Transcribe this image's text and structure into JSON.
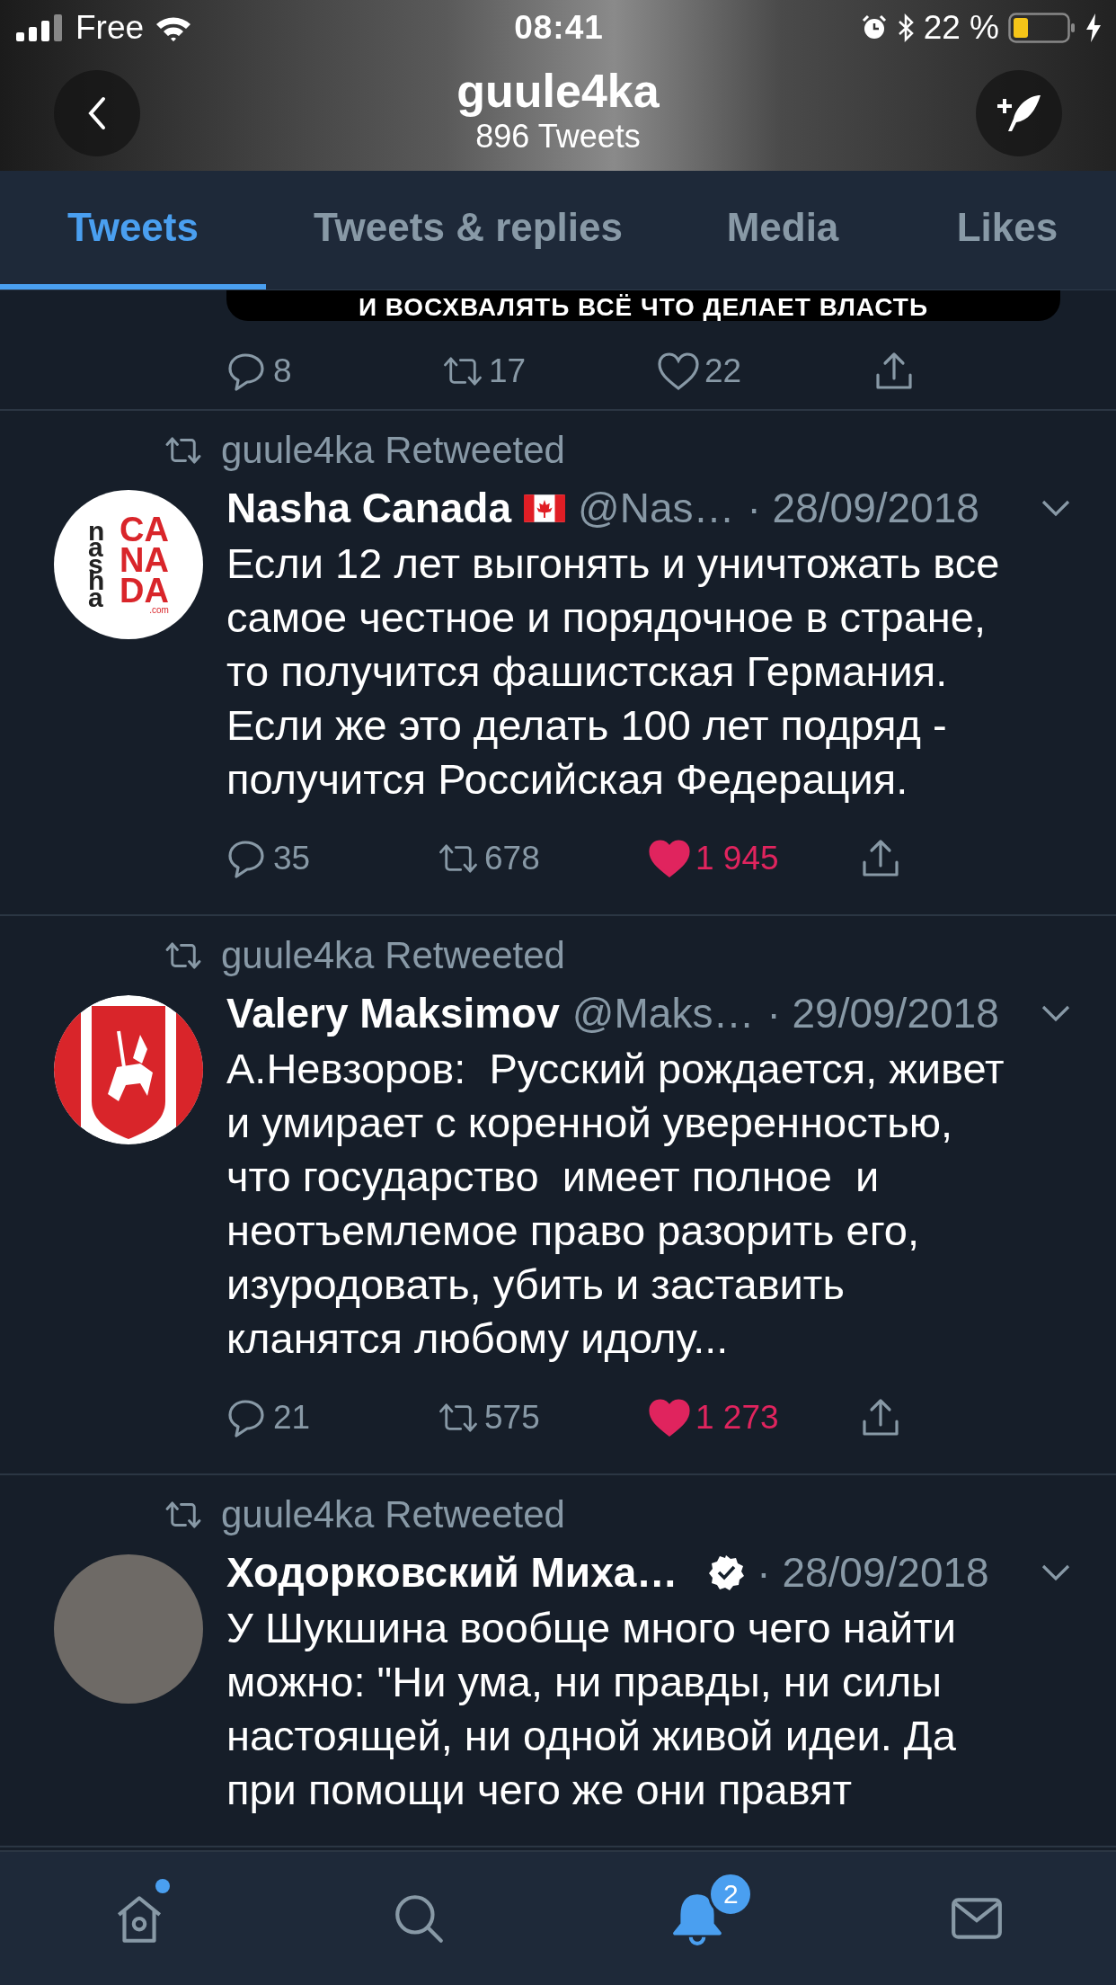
{
  "status_bar": {
    "carrier": "Free",
    "time": "08:41",
    "battery": "22 %"
  },
  "header": {
    "title": "guule4ka",
    "subtitle": "896 Tweets"
  },
  "tabs": [
    {
      "label": "Tweets",
      "selected": true
    },
    {
      "label": "Tweets & replies",
      "selected": false
    },
    {
      "label": "Media",
      "selected": false
    },
    {
      "label": "Likes",
      "selected": false
    }
  ],
  "partial_tweet": {
    "media_caption": "И ВОСХВАЛЯТЬ ВСЁ ЧТО ДЕЛАЕТ ВЛАСТЬ",
    "replies": "8",
    "retweets": "17",
    "likes": "22",
    "liked": false
  },
  "tweets": [
    {
      "retweeted_by": "guule4ka Retweeted",
      "avatar": {
        "kind": "logo",
        "side": "nasha",
        "lines": [
          "CA",
          "NA",
          "DA"
        ],
        "small": ".com"
      },
      "name": "Nasha Canada",
      "flag": true,
      "verified": false,
      "handle": "@Nas…",
      "date": "· 28/09/2018",
      "text": "Если 12 лет выгонять и уничтожать все самое честное и порядочное в стране, то получится фашистская Германия. Если же это делать 100 лет подряд - получится Российская Федерация.",
      "replies": "35",
      "retweets": "678",
      "likes": "1 945",
      "liked": true
    },
    {
      "retweeted_by": "guule4ka Retweeted",
      "avatar": {
        "kind": "emblem"
      },
      "name": "Valery Maksimov",
      "flag": false,
      "verified": false,
      "handle": "@Maks…",
      "date": "· 29/09/2018",
      "text": "А.Невзоров:  Русский рождается, живет и умирает с коренной уверенностью, что государство  имеет полное  и неотъемлемое право разорить его, изуродовать, убить и заставить кланятся любому идолу...",
      "replies": "21",
      "retweets": "575",
      "likes": "1 273",
      "liked": true
    },
    {
      "retweeted_by": "guule4ka Retweeted",
      "avatar": {
        "kind": "photo"
      },
      "name": "Ходорковский Миха…",
      "flag": false,
      "verified": true,
      "date": "· 28/09/2018",
      "text": "У Шукшина вообще много чего найти можно: \"Ни ума, ни правды, ни силы настоящей, ни одной живой идеи. Да при помощи чего же они правят"
    }
  ],
  "bottom_nav": [
    {
      "kind": "home",
      "selected": false,
      "dot": true
    },
    {
      "kind": "search",
      "selected": false,
      "dot": false
    },
    {
      "kind": "notifications",
      "selected": true,
      "dot": false,
      "count": "2"
    },
    {
      "kind": "messages",
      "selected": false,
      "dot": false
    }
  ]
}
